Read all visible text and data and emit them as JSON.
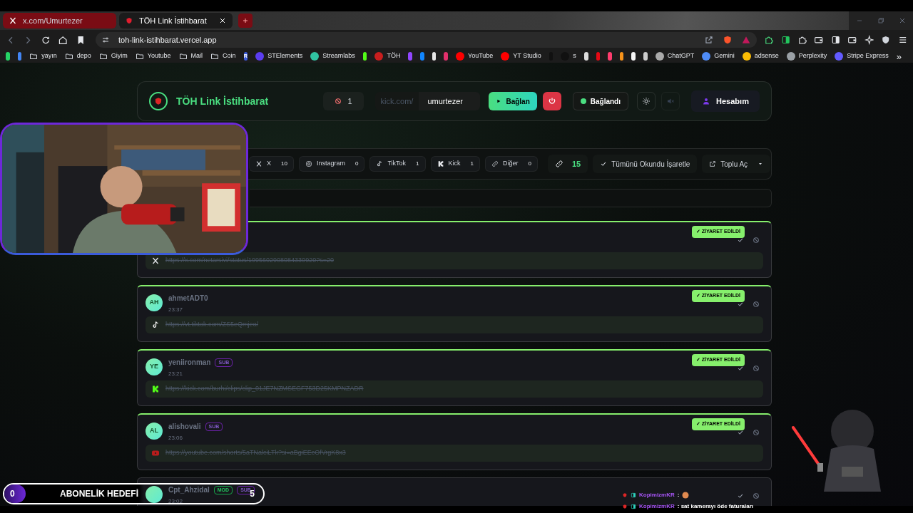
{
  "browser": {
    "tabs": [
      {
        "title": "x.com/Umurtezer",
        "selected": false,
        "kind": "x"
      },
      {
        "title": "TÖH Link İstihbarat",
        "selected": true,
        "kind": "toh"
      }
    ],
    "url": "toh-link-istihbarat.vercel.app",
    "bookmarks": [
      {
        "kind": "site",
        "color": "#25d366"
      },
      {
        "kind": "site",
        "color": "#4285f4"
      },
      {
        "kind": "folder",
        "label": "yayın"
      },
      {
        "kind": "folder",
        "label": "depo"
      },
      {
        "kind": "folder",
        "label": "Giyim"
      },
      {
        "kind": "folder",
        "label": "Youtube"
      },
      {
        "kind": "folder",
        "label": "Mail"
      },
      {
        "kind": "folder",
        "label": "Coin"
      },
      {
        "kind": "site",
        "color": "#3b5bdb",
        "glyph": "R"
      },
      {
        "kind": "site",
        "color": "#5b3df0",
        "label": "STElements"
      },
      {
        "kind": "site",
        "color": "#31c3a2",
        "label": "Streamlabs"
      },
      {
        "kind": "site",
        "color": "#53fc18"
      },
      {
        "kind": "site",
        "color": "#c81e1e",
        "label": "TÖH"
      },
      {
        "kind": "site",
        "color": "#9146ff"
      },
      {
        "kind": "site",
        "color": "#1185fe"
      },
      {
        "kind": "site",
        "color": "#e5e5e5"
      },
      {
        "kind": "site",
        "color": "#e1306c"
      },
      {
        "kind": "site",
        "color": "#ff0000",
        "label": "YouTube"
      },
      {
        "kind": "site",
        "color": "#ff0000",
        "label": "YT Studio"
      },
      {
        "kind": "site",
        "color": "#111111"
      },
      {
        "kind": "site",
        "color": "#111111",
        "label": "s"
      },
      {
        "kind": "site",
        "color": "#dddddd"
      },
      {
        "kind": "site",
        "color": "#e50914"
      },
      {
        "kind": "site",
        "color": "#ff3c6e"
      },
      {
        "kind": "site",
        "color": "#f7931a"
      },
      {
        "kind": "site",
        "color": "#f5f5f5"
      },
      {
        "kind": "site",
        "color": "#cccccc"
      },
      {
        "kind": "site",
        "color": "#aaaaaa",
        "label": "ChatGPT"
      },
      {
        "kind": "site",
        "color": "#4f8cf7",
        "label": "Gemini"
      },
      {
        "kind": "site",
        "color": "#fbbc04",
        "label": "adsense"
      },
      {
        "kind": "site",
        "color": "#9aa0a6",
        "label": "Perplexity"
      },
      {
        "kind": "site",
        "color": "#635bff",
        "label": "Stripe Express"
      },
      {
        "kind": "more",
        "glyph": "»"
      }
    ]
  },
  "header": {
    "title": "TÖH Link İstihbarat",
    "blocked_count": "1",
    "channel_prefix": "kick.com/",
    "channel_value": "umurtezer",
    "connect_label": "Bağlan",
    "status_label": "Bağlandı",
    "connected": true,
    "muted_disabled": true,
    "account_label": "Hesabım"
  },
  "filters": [
    {
      "kind": "x",
      "label": "X",
      "count": "10"
    },
    {
      "kind": "instagram",
      "label": "Instagram",
      "count": "0"
    },
    {
      "kind": "tiktok",
      "label": "TikTok",
      "count": "1"
    },
    {
      "kind": "kick",
      "label": "Kick",
      "count": "1"
    },
    {
      "kind": "link",
      "label": "Diğer",
      "count": "0"
    }
  ],
  "actions": {
    "link_count": "15",
    "mark_all_label": "Tümünü Okundu İşaretle",
    "bulk_open_label": "Toplu Aç"
  },
  "cards": [
    {
      "kind": "x",
      "url": "https://x.com/netarsivi/status/1995602908084330920?s=20",
      "visited": true,
      "visited_label": "✓ ZİYARET EDİLDİ"
    },
    {
      "initials": "AH",
      "user": "ahmetADT0",
      "time": "23:37",
      "kind": "tiktok",
      "url": "https://vt.tiktok.com/ZS5eQmjeo/",
      "visited": true,
      "visited_label": "✓ ZİYARET EDİLDİ"
    },
    {
      "initials": "YE",
      "user": "yeniironman",
      "time": "23:21",
      "badges": [
        {
          "kind": "sub",
          "label": "SUB"
        }
      ],
      "kind": "kick",
      "url": "https://kick.com/burhi/clips/clip_01JE7NZMSEGF753D25KMPNZADR",
      "visited": true,
      "visited_label": "✓ ZİYARET EDİLDİ"
    },
    {
      "initials": "AL",
      "user": "alishovali",
      "time": "23:06",
      "badges": [
        {
          "kind": "sub",
          "label": "SUB"
        }
      ],
      "kind": "youtube",
      "url": "https://youtube.com/shorts/5aTNalciLTk?si=aBgiEEcOfVrgK8x3",
      "visited": true,
      "visited_label": "✓ ZİYARET EDİLDİ"
    },
    {
      "user": "Cpt_Ahzidal",
      "time": "23:02",
      "badges": [
        {
          "kind": "mod",
          "label": "MOD"
        },
        {
          "kind": "sub",
          "label": "SUB"
        }
      ],
      "visited": false
    }
  ],
  "overlay": {
    "goal": {
      "current": "0",
      "title": "ABONELİK HEDEFİ",
      "target": "5"
    },
    "chat": [
      {
        "user": "KopimizmKR",
        "text": ":",
        "emote": true
      },
      {
        "user": "KopimizmKR",
        "text": ": sat kamerayı öde faturaları",
        "emote": false
      }
    ]
  }
}
